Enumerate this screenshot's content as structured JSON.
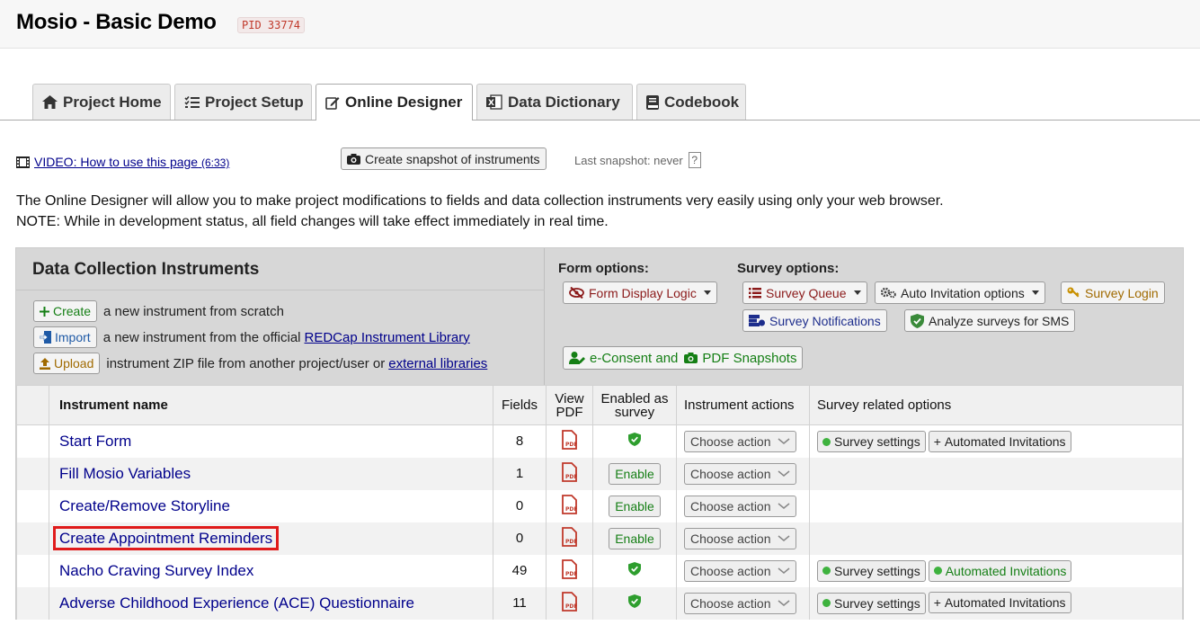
{
  "header": {
    "title": "Mosio - Basic Demo",
    "pid": "PID 33774"
  },
  "tabs": [
    {
      "label": "Project Home",
      "icon": "home-icon"
    },
    {
      "label": "Project Setup",
      "icon": "checklist-icon"
    },
    {
      "label": "Online Designer",
      "icon": "edit-icon"
    },
    {
      "label": "Data Dictionary",
      "icon": "excel-icon"
    },
    {
      "label": "Codebook",
      "icon": "book-icon"
    }
  ],
  "video": {
    "label": "VIDEO: How to use this page",
    "duration": "(6:33)"
  },
  "snapshot": {
    "button": "Create snapshot of instruments",
    "last": "Last snapshot: never",
    "help": "?"
  },
  "intro": {
    "line1": "The Online Designer will allow you to make project modifications to fields and data collection instruments very easily using only your web browser.",
    "line2": "NOTE: While in development status, all field changes will take effect immediately in real time."
  },
  "dci": {
    "title": "Data Collection Instruments",
    "create_btn": "Create",
    "create_text": "a new instrument from scratch",
    "import_btn": "Import",
    "import_text": "a new instrument from the official",
    "import_link": "REDCap Instrument Library",
    "upload_btn": "Upload",
    "upload_text": "instrument ZIP file from another project/user or",
    "upload_link": "external libraries"
  },
  "form_options": {
    "label": "Form options:",
    "display_logic": "Form Display Logic"
  },
  "survey_options": {
    "label": "Survey options:",
    "queue": "Survey Queue",
    "auto_invite": "Auto Invitation options",
    "login": "Survey Login",
    "notifications": "Survey Notifications",
    "sms": "Analyze surveys for SMS"
  },
  "econsent": {
    "part1": "e-Consent and",
    "part2": "PDF Snapshots"
  },
  "table": {
    "headers": {
      "name": "Instrument name",
      "fields": "Fields",
      "view_pdf_1": "View",
      "view_pdf_2": "PDF",
      "enabled_1": "Enabled as",
      "enabled_2": "survey",
      "actions": "Instrument actions",
      "survey_related": "Survey related options"
    },
    "choose_action": "Choose action",
    "enable_label": "Enable",
    "survey_settings": "Survey settings",
    "automated_invites": "Automated Invitations",
    "rows": [
      {
        "name": "Start Form",
        "fields": "8"
      },
      {
        "name": "Fill Mosio Variables",
        "fields": "1"
      },
      {
        "name": "Create/Remove Storyline",
        "fields": "0"
      },
      {
        "name": "Create Appointment Reminders",
        "fields": "0"
      },
      {
        "name": "Nacho Craving Survey Index",
        "fields": "49"
      },
      {
        "name": "Adverse Childhood Experience (ACE) Questionnaire",
        "fields": "11"
      }
    ]
  },
  "colors": {
    "link": "#00008b",
    "highlight": "#e01b1b",
    "green": "#157f15",
    "pdf_red": "#c0392b"
  }
}
